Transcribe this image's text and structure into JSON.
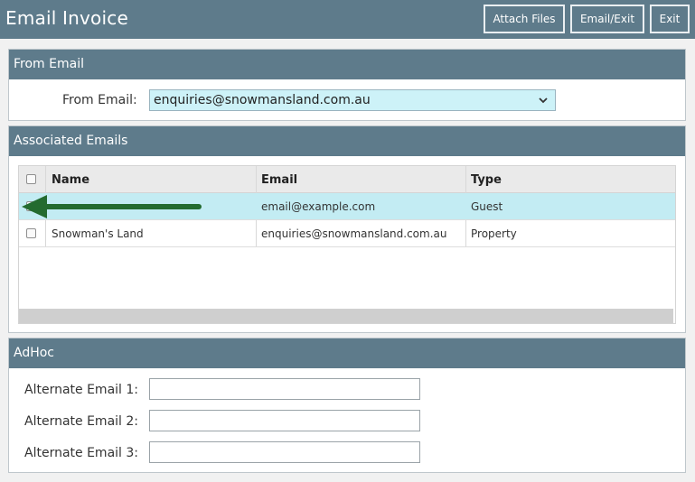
{
  "header": {
    "title": "Email Invoice",
    "buttons": {
      "attach": "Attach Files",
      "email_exit": "Email/Exit",
      "exit": "Exit"
    }
  },
  "from_email": {
    "section_title": "From Email",
    "label": "From Email:",
    "selected_value": "enquiries@snowmansland.com.au"
  },
  "associated": {
    "section_title": "Associated Emails",
    "columns": {
      "name": "Name",
      "email": "Email",
      "type": "Type"
    },
    "rows": [
      {
        "name": "",
        "email": "email@example.com",
        "type": "Guest",
        "checked": true
      },
      {
        "name": "Snowman's Land",
        "email": "enquiries@snowmansland.com.au",
        "type": "Property",
        "checked": false
      }
    ]
  },
  "adhoc": {
    "section_title": "AdHoc",
    "fields": [
      {
        "label": "Alternate Email 1:",
        "value": ""
      },
      {
        "label": "Alternate Email 2:",
        "value": ""
      },
      {
        "label": "Alternate Email 3:",
        "value": ""
      }
    ]
  },
  "colors": {
    "header": "#5e7b8b",
    "select_bg": "#cdf2f8",
    "selected_row": "#c3ecf3",
    "arrow": "#236b2f"
  }
}
